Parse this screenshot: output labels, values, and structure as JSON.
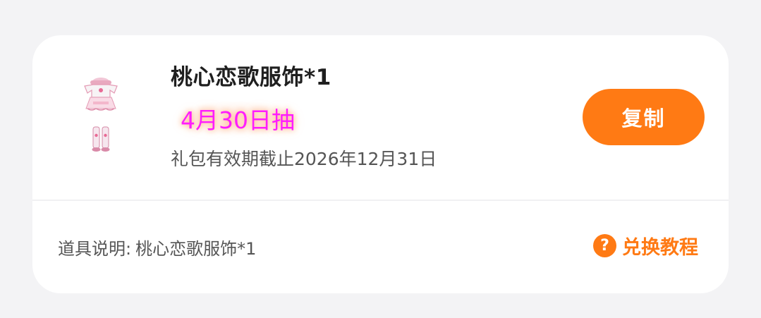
{
  "gift": {
    "title": "桃心恋歌服饰*1",
    "highlight": "4月30日抽",
    "expiry": "礼包有效期截止2026年12月31日",
    "copy_label": "复制",
    "image_icon": "outfit-thumbnail-icon"
  },
  "details": {
    "desc_label": "道具说明:",
    "desc_value": "桃心恋歌服饰*1",
    "tutorial_label": "兑换教程",
    "tutorial_icon": "question-circle-icon"
  },
  "colors": {
    "accent": "#ff7a14",
    "highlight_text": "#ff1cff",
    "background": "#f3f3f5",
    "card": "#ffffff"
  }
}
